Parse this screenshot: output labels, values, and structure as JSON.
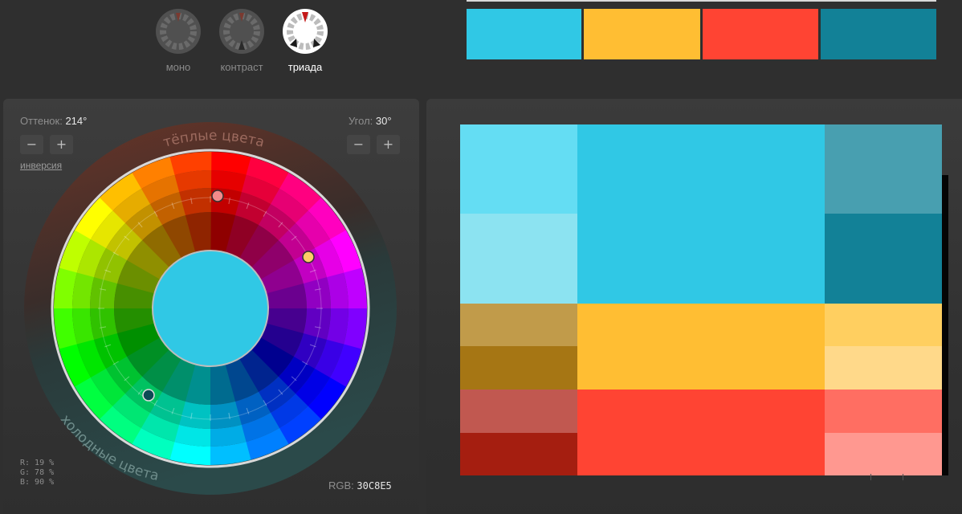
{
  "schemes": [
    {
      "label": "моно",
      "active": false
    },
    {
      "label": "контраст",
      "active": false
    },
    {
      "label": "триада",
      "active": true
    }
  ],
  "palette": {
    "primary": "#30C8E5",
    "secondary": "#FFBE33",
    "tertiary": "#FF4433",
    "complement": "#128197"
  },
  "wheel": {
    "hue_label": "Оттенок:",
    "hue_value": "214°",
    "angle_label": "Угол:",
    "angle_value": "30°",
    "minus": "−",
    "plus": "+",
    "invert_link": "инверсия",
    "warm_label": "тёплые цвета",
    "cold_label": "холодные цвета",
    "rgb_r": "R: 19 %",
    "rgb_g": "G: 78 %",
    "rgb_b": "B: 90 %",
    "rgb_label": "RGB:",
    "rgb_hex": "30C8E5",
    "center_color": "#30C8E5",
    "markers": [
      "#F28A8A",
      "#FFCC66",
      "#0C4A55"
    ]
  },
  "variations": [
    {
      "color": "#64DDF3"
    },
    {
      "color": "#30C8E5"
    },
    {
      "color": "#489FB0"
    },
    {
      "color": "#8CE3F1"
    },
    {
      "color": "#30C8E5"
    },
    {
      "color": "#128197"
    },
    {
      "color": "#C19B4A"
    },
    {
      "color": "#FFBE33"
    },
    {
      "color": "#FFCF60"
    },
    {
      "color": "#A67614"
    },
    {
      "color": "#FFBE33"
    },
    {
      "color": "#FFD98A"
    },
    {
      "color": "#C15850"
    },
    {
      "color": "#FF4433"
    },
    {
      "color": "#FF6E62"
    },
    {
      "color": "#A51E10"
    },
    {
      "color": "#FF4433"
    },
    {
      "color": "#FF9890"
    }
  ]
}
